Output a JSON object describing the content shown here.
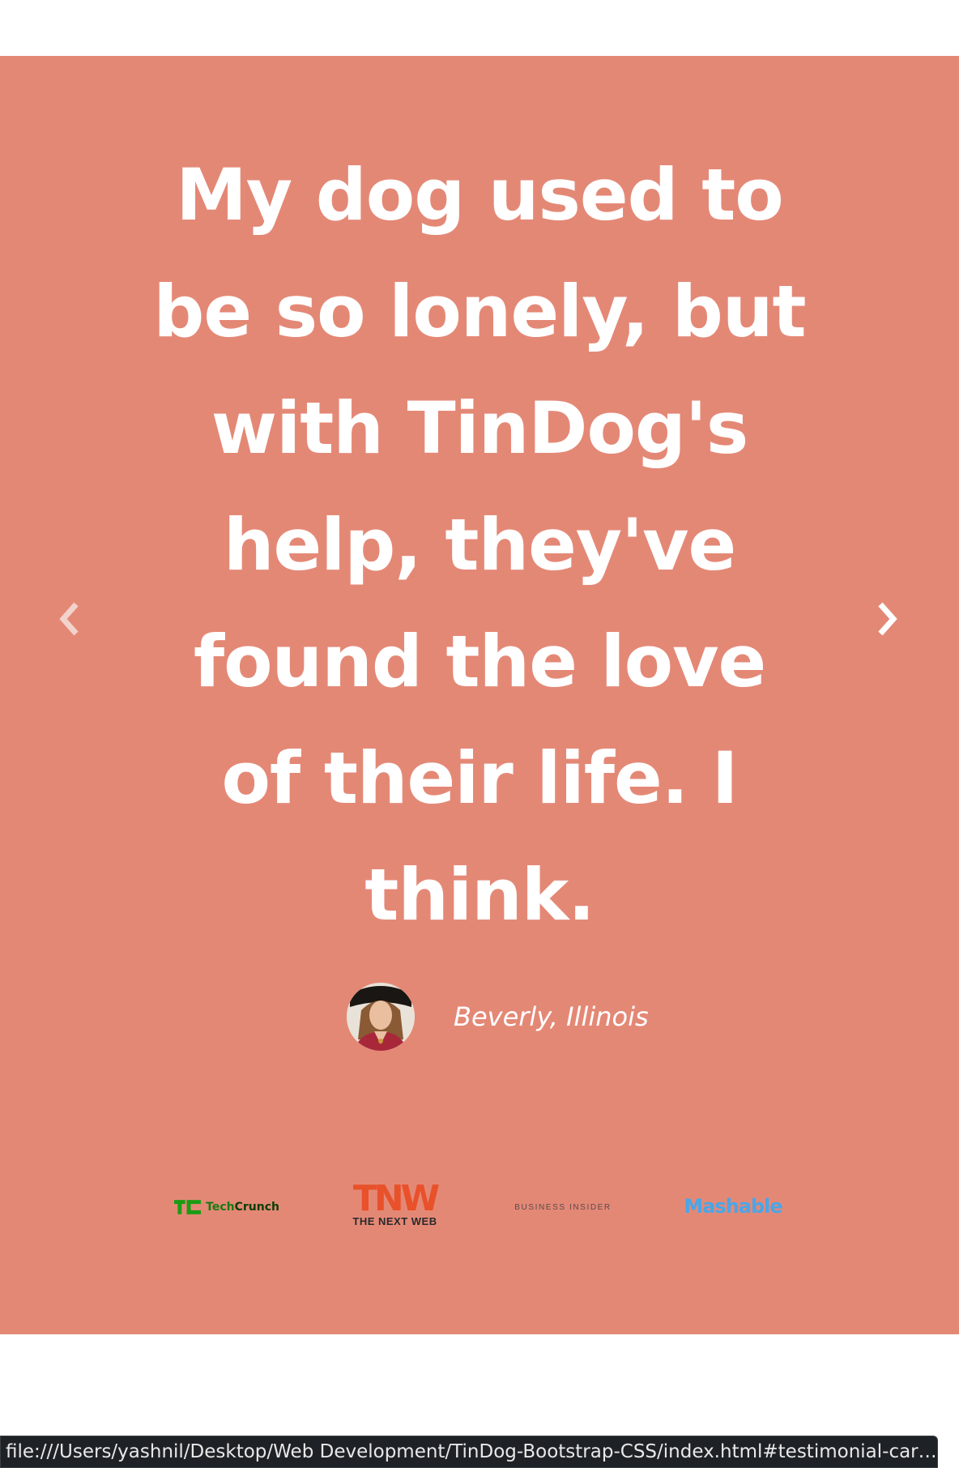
{
  "testimonial": {
    "quote_lines": [
      "My dog used to",
      "be so lonely, but",
      "with TinDog's",
      "help, they've",
      "found the love",
      "of their life. I",
      "think."
    ],
    "author": "Beverly, Illinois",
    "avatar_icon": "woman-portrait-avatar"
  },
  "carousel": {
    "prev_icon": "chevron-left-icon",
    "next_icon": "chevron-right-icon"
  },
  "press": {
    "logos": [
      {
        "name": "techcrunch-logo",
        "mark": "TC",
        "text_a": "Tech",
        "text_b": "Crunch"
      },
      {
        "name": "the-next-web-logo",
        "mark": "TNW",
        "sub": "THE NEXT WEB"
      },
      {
        "name": "business-insider-logo",
        "text": "BUSINESS INSIDER"
      },
      {
        "name": "mashable-logo",
        "text": "Mashable"
      }
    ]
  },
  "colors": {
    "section_bg": "#e48876",
    "text": "#ffffff",
    "tnw": "#e8512a",
    "mashable": "#4aa6e8",
    "techcrunch": "#1a7a12"
  },
  "status_bar": {
    "url": "file:///Users/yashnil/Desktop/Web Development/TinDog-Bootstrap-CSS/index.html#testimonial-car…"
  }
}
